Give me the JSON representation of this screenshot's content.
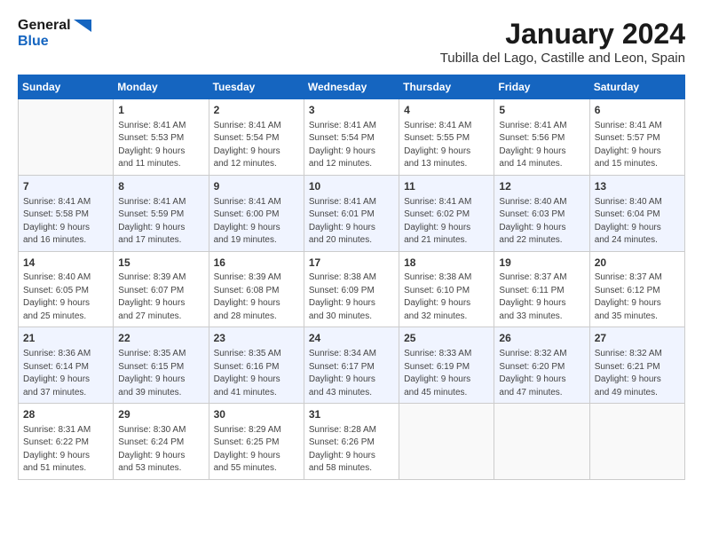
{
  "header": {
    "logo_line1": "General",
    "logo_line2": "Blue",
    "month_year": "January 2024",
    "location": "Tubilla del Lago, Castille and Leon, Spain"
  },
  "weekdays": [
    "Sunday",
    "Monday",
    "Tuesday",
    "Wednesday",
    "Thursday",
    "Friday",
    "Saturday"
  ],
  "weeks": [
    [
      {
        "day": "",
        "info": ""
      },
      {
        "day": "1",
        "info": "Sunrise: 8:41 AM\nSunset: 5:53 PM\nDaylight: 9 hours\nand 11 minutes."
      },
      {
        "day": "2",
        "info": "Sunrise: 8:41 AM\nSunset: 5:54 PM\nDaylight: 9 hours\nand 12 minutes."
      },
      {
        "day": "3",
        "info": "Sunrise: 8:41 AM\nSunset: 5:54 PM\nDaylight: 9 hours\nand 12 minutes."
      },
      {
        "day": "4",
        "info": "Sunrise: 8:41 AM\nSunset: 5:55 PM\nDaylight: 9 hours\nand 13 minutes."
      },
      {
        "day": "5",
        "info": "Sunrise: 8:41 AM\nSunset: 5:56 PM\nDaylight: 9 hours\nand 14 minutes."
      },
      {
        "day": "6",
        "info": "Sunrise: 8:41 AM\nSunset: 5:57 PM\nDaylight: 9 hours\nand 15 minutes."
      }
    ],
    [
      {
        "day": "7",
        "info": "Sunrise: 8:41 AM\nSunset: 5:58 PM\nDaylight: 9 hours\nand 16 minutes."
      },
      {
        "day": "8",
        "info": "Sunrise: 8:41 AM\nSunset: 5:59 PM\nDaylight: 9 hours\nand 17 minutes."
      },
      {
        "day": "9",
        "info": "Sunrise: 8:41 AM\nSunset: 6:00 PM\nDaylight: 9 hours\nand 19 minutes."
      },
      {
        "day": "10",
        "info": "Sunrise: 8:41 AM\nSunset: 6:01 PM\nDaylight: 9 hours\nand 20 minutes."
      },
      {
        "day": "11",
        "info": "Sunrise: 8:41 AM\nSunset: 6:02 PM\nDaylight: 9 hours\nand 21 minutes."
      },
      {
        "day": "12",
        "info": "Sunrise: 8:40 AM\nSunset: 6:03 PM\nDaylight: 9 hours\nand 22 minutes."
      },
      {
        "day": "13",
        "info": "Sunrise: 8:40 AM\nSunset: 6:04 PM\nDaylight: 9 hours\nand 24 minutes."
      }
    ],
    [
      {
        "day": "14",
        "info": "Sunrise: 8:40 AM\nSunset: 6:05 PM\nDaylight: 9 hours\nand 25 minutes."
      },
      {
        "day": "15",
        "info": "Sunrise: 8:39 AM\nSunset: 6:07 PM\nDaylight: 9 hours\nand 27 minutes."
      },
      {
        "day": "16",
        "info": "Sunrise: 8:39 AM\nSunset: 6:08 PM\nDaylight: 9 hours\nand 28 minutes."
      },
      {
        "day": "17",
        "info": "Sunrise: 8:38 AM\nSunset: 6:09 PM\nDaylight: 9 hours\nand 30 minutes."
      },
      {
        "day": "18",
        "info": "Sunrise: 8:38 AM\nSunset: 6:10 PM\nDaylight: 9 hours\nand 32 minutes."
      },
      {
        "day": "19",
        "info": "Sunrise: 8:37 AM\nSunset: 6:11 PM\nDaylight: 9 hours\nand 33 minutes."
      },
      {
        "day": "20",
        "info": "Sunrise: 8:37 AM\nSunset: 6:12 PM\nDaylight: 9 hours\nand 35 minutes."
      }
    ],
    [
      {
        "day": "21",
        "info": "Sunrise: 8:36 AM\nSunset: 6:14 PM\nDaylight: 9 hours\nand 37 minutes."
      },
      {
        "day": "22",
        "info": "Sunrise: 8:35 AM\nSunset: 6:15 PM\nDaylight: 9 hours\nand 39 minutes."
      },
      {
        "day": "23",
        "info": "Sunrise: 8:35 AM\nSunset: 6:16 PM\nDaylight: 9 hours\nand 41 minutes."
      },
      {
        "day": "24",
        "info": "Sunrise: 8:34 AM\nSunset: 6:17 PM\nDaylight: 9 hours\nand 43 minutes."
      },
      {
        "day": "25",
        "info": "Sunrise: 8:33 AM\nSunset: 6:19 PM\nDaylight: 9 hours\nand 45 minutes."
      },
      {
        "day": "26",
        "info": "Sunrise: 8:32 AM\nSunset: 6:20 PM\nDaylight: 9 hours\nand 47 minutes."
      },
      {
        "day": "27",
        "info": "Sunrise: 8:32 AM\nSunset: 6:21 PM\nDaylight: 9 hours\nand 49 minutes."
      }
    ],
    [
      {
        "day": "28",
        "info": "Sunrise: 8:31 AM\nSunset: 6:22 PM\nDaylight: 9 hours\nand 51 minutes."
      },
      {
        "day": "29",
        "info": "Sunrise: 8:30 AM\nSunset: 6:24 PM\nDaylight: 9 hours\nand 53 minutes."
      },
      {
        "day": "30",
        "info": "Sunrise: 8:29 AM\nSunset: 6:25 PM\nDaylight: 9 hours\nand 55 minutes."
      },
      {
        "day": "31",
        "info": "Sunrise: 8:28 AM\nSunset: 6:26 PM\nDaylight: 9 hours\nand 58 minutes."
      },
      {
        "day": "",
        "info": ""
      },
      {
        "day": "",
        "info": ""
      },
      {
        "day": "",
        "info": ""
      }
    ]
  ]
}
